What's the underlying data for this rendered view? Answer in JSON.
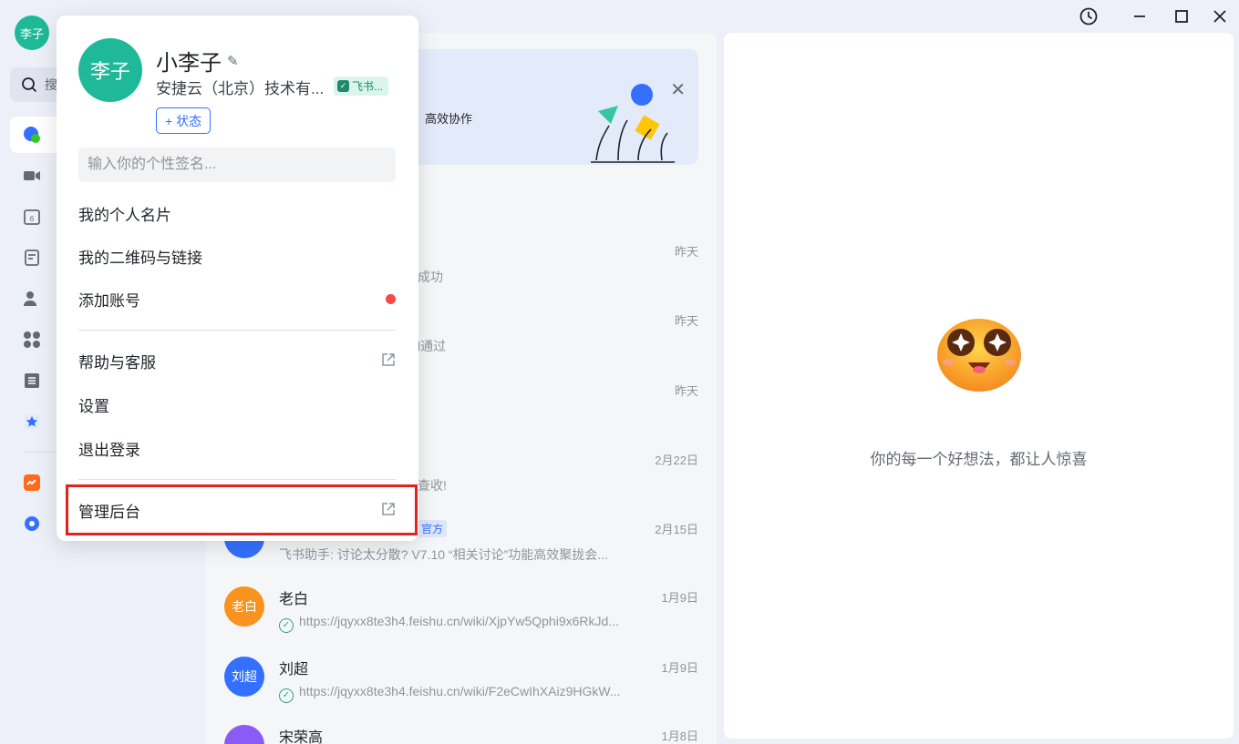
{
  "window": {
    "controls": [
      "history-icon",
      "minimize-icon",
      "maximize-icon",
      "close-icon"
    ]
  },
  "rail": {
    "avatar_text": "李子",
    "search_placeholder": "搜"
  },
  "banner": {
    "text": "高效协作"
  },
  "chats": [
    {
      "time": "昨天",
      "preview": "成功"
    },
    {
      "time": "昨天",
      "preview": "l通过"
    },
    {
      "time": "昨天",
      "preview": ""
    },
    {
      "time": "2月22日",
      "preview": "查收!"
    },
    {
      "time": "2月15日",
      "tag": "官方",
      "preview": "飞书助手: 讨论太分散? V7.10 “相关讨论”功能高效聚拢会..."
    },
    {
      "name": "老白",
      "avatar": "老白",
      "avatar_color": "#f7931e",
      "time": "1月9日",
      "preview": "https://jqyxx8te3h4.feishu.cn/wiki/XjpYw5Qphi9x6RkJd..."
    },
    {
      "name": "刘超",
      "avatar": "刘超",
      "avatar_color": "#3370ff",
      "time": "1月9日",
      "preview": "https://jqyxx8te3h4.feishu.cn/wiki/F2eCwIhXAiz9HGkW..."
    },
    {
      "name": "宋荣高",
      "avatar": "",
      "avatar_color": "#8a5cf5",
      "time": "1月8日",
      "preview": ""
    }
  ],
  "right_panel": {
    "caption": "你的每一个好想法，都让人惊喜"
  },
  "popover": {
    "avatar_text": "李子",
    "name": "小李子",
    "company": "安捷云（北京）技术有...",
    "tag": "飞书...",
    "status_button": "+ 状态",
    "signature_placeholder": "输入你的个性签名...",
    "menu": {
      "card": "我的个人名片",
      "qrcode": "我的二维码与链接",
      "add_account": "添加账号",
      "help": "帮助与客服",
      "settings": "设置",
      "logout": "退出登录",
      "admin": "管理后台"
    }
  },
  "colors": {
    "accent": "#3370ff",
    "avatar_green": "#1fb99a",
    "highlight_red": "#e0231c",
    "notify_red": "#f54a45"
  }
}
